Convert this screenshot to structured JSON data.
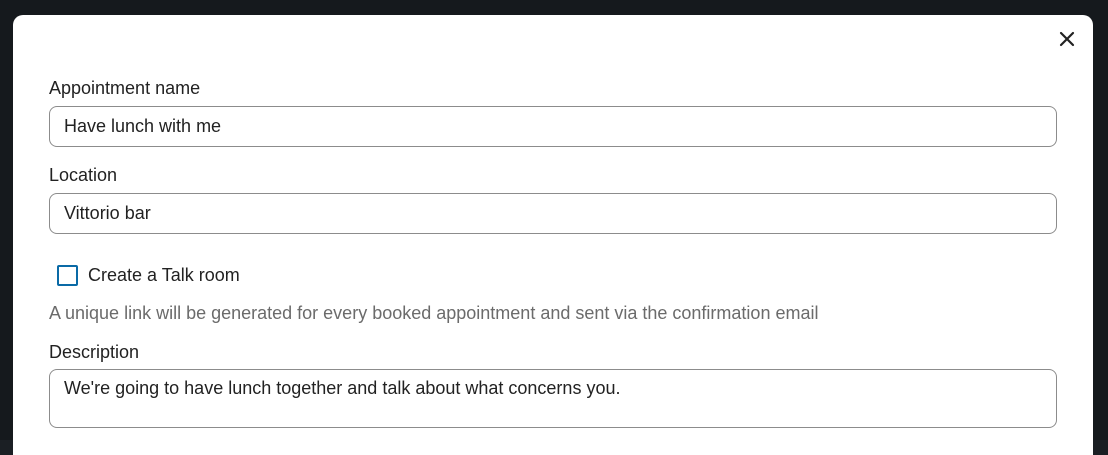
{
  "dialog": {
    "close_icon": "close-icon"
  },
  "form": {
    "appointment_name": {
      "label": "Appointment name",
      "value": "Have lunch with me"
    },
    "location": {
      "label": "Location",
      "value": "Vittorio bar"
    },
    "talk_room": {
      "label": "Create a Talk room",
      "checked": false,
      "accent_color": "#0a6aa6"
    },
    "talk_room_hint": "A unique link will be generated for every booked appointment and sent via the confirmation email",
    "description": {
      "label": "Description",
      "value": "We're going to have lunch together and talk about what concerns you."
    }
  }
}
